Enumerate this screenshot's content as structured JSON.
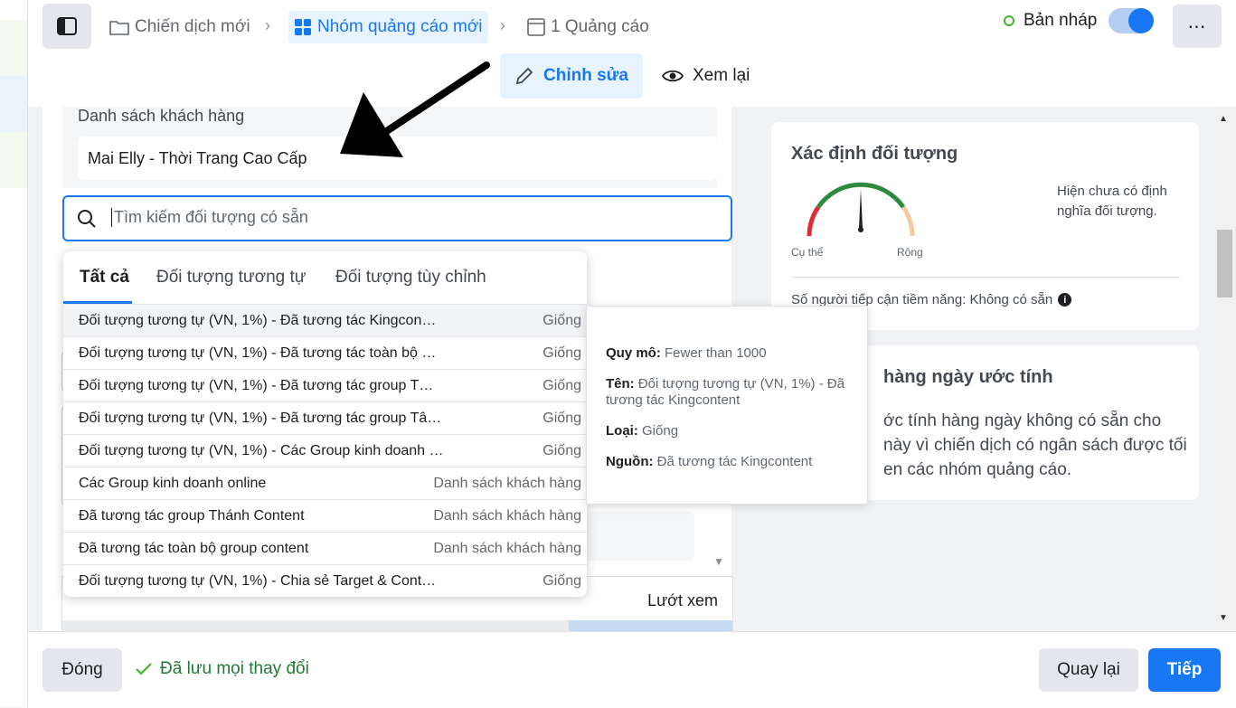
{
  "breadcrumb": {
    "campaign": "Chiến dịch mới",
    "adset": "Nhóm quảng cáo mới",
    "ad": "1 Quảng cáo"
  },
  "status": {
    "label": "Bản nháp"
  },
  "modes": {
    "edit": "Chỉnh sửa",
    "review": "Xem lại"
  },
  "customer_list": {
    "label": "Danh sách khách hàng",
    "value": "Mai Elly - Thời Trang Cao Cấp"
  },
  "search": {
    "placeholder": "Tìm kiếm đối tượng có sẵn"
  },
  "dropdown": {
    "tabs": [
      "Tất cả",
      "Đối tượng tương tự",
      "Đối tượng tùy chỉnh"
    ],
    "items": [
      {
        "name": "Đối tượng tương tự (VN, 1%) - Đã tương tác Kingcon…",
        "type": "Giống"
      },
      {
        "name": "Đối tượng tương tự (VN, 1%) - Đã tương tác toàn bộ …",
        "type": "Giống"
      },
      {
        "name": "Đối tượng tương tự (VN, 1%) - Đã tương tác group T…",
        "type": "Giống"
      },
      {
        "name": "Đối tượng tương tự (VN, 1%) - Đã tương tác group Tâ…",
        "type": "Giống"
      },
      {
        "name": "Đối tượng tương tự (VN, 1%) - Các Group kinh doanh …",
        "type": "Giống"
      },
      {
        "name": "Các Group kinh doanh online",
        "type": "Danh sách khách hàng"
      },
      {
        "name": "Đã tương tác group Thánh Content",
        "type": "Danh sách khách hàng"
      },
      {
        "name": "Đã tương tác toàn bộ group content",
        "type": "Danh sách khách hàng"
      },
      {
        "name": "Đối tượng tương tự (VN, 1%) - Chia sẻ Target & Cont…",
        "type": "Giống"
      }
    ]
  },
  "tooltip": {
    "scale_label": "Quy mô:",
    "scale_value": "Fewer than 1000",
    "name_label": "Tên:",
    "name_value": "Đối tượng tương tự (VN, 1%) - Đã tương tác Kingcontent",
    "type_label": "Loại:",
    "type_value": "Giống",
    "source_label": "Nguồn:",
    "source_value": "Đã tương tác Kingcontent"
  },
  "audience_def": {
    "title": "Xác định đối tượng",
    "gauge_left": "Cụ thể",
    "gauge_right": "Rộng",
    "undefined_text": "Hiện chưa có định nghĩa đối tượng.",
    "reach": "Số người tiếp cận tiềm năng: Không có sẵn"
  },
  "daily": {
    "title_partial": "hàng ngày ước tính",
    "text_l1": "ớc tính hàng ngày không có sẵn cho",
    "text_l2": "này vì chiến dịch có ngân sách được tối",
    "text_l3": "en các nhóm quảng cáo."
  },
  "map": {
    "browse": "Lướt xem"
  },
  "footer": {
    "close": "Đóng",
    "saved": "Đã lưu mọi thay đổi",
    "back": "Quay lại",
    "next": "Tiếp"
  },
  "colors": {
    "accent": "#1877f2",
    "success": "#42b72a"
  }
}
